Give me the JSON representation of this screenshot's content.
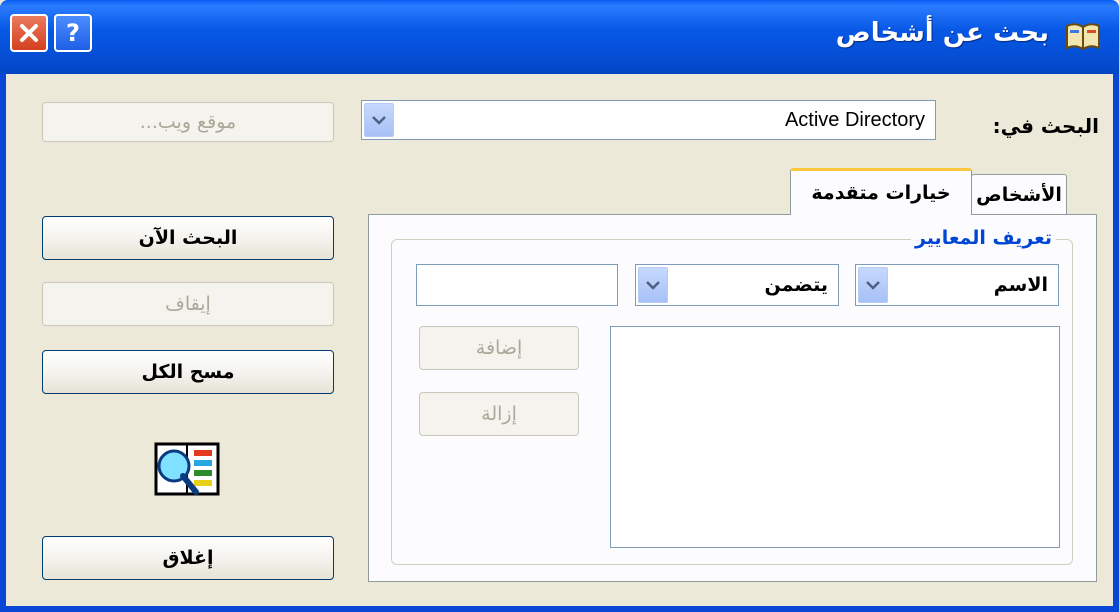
{
  "window": {
    "title": "بحث عن أشخاص",
    "help_glyph": "?",
    "close_glyph": "✕"
  },
  "search_in": {
    "label": "البحث في:",
    "value": "Active Directory"
  },
  "tabs": [
    {
      "label": "الأشخاص"
    },
    {
      "label": "خيارات متقدمة"
    }
  ],
  "criteria": {
    "group_label": "تعريف المعايير",
    "field_value": "الاسم",
    "condition_value": "يتضمن",
    "text_value": "",
    "add_label": "إضافة",
    "remove_label": "إزالة"
  },
  "buttons": {
    "website": "موقع ويب...",
    "find_now": "البحث الآن",
    "stop": "إيقاف",
    "clear_all": "مسح الكل",
    "close": "إغلاق"
  },
  "colors": {
    "titlebar": "#0550d8",
    "accent_tab": "#ffc83c",
    "group_label": "#0046d5"
  }
}
